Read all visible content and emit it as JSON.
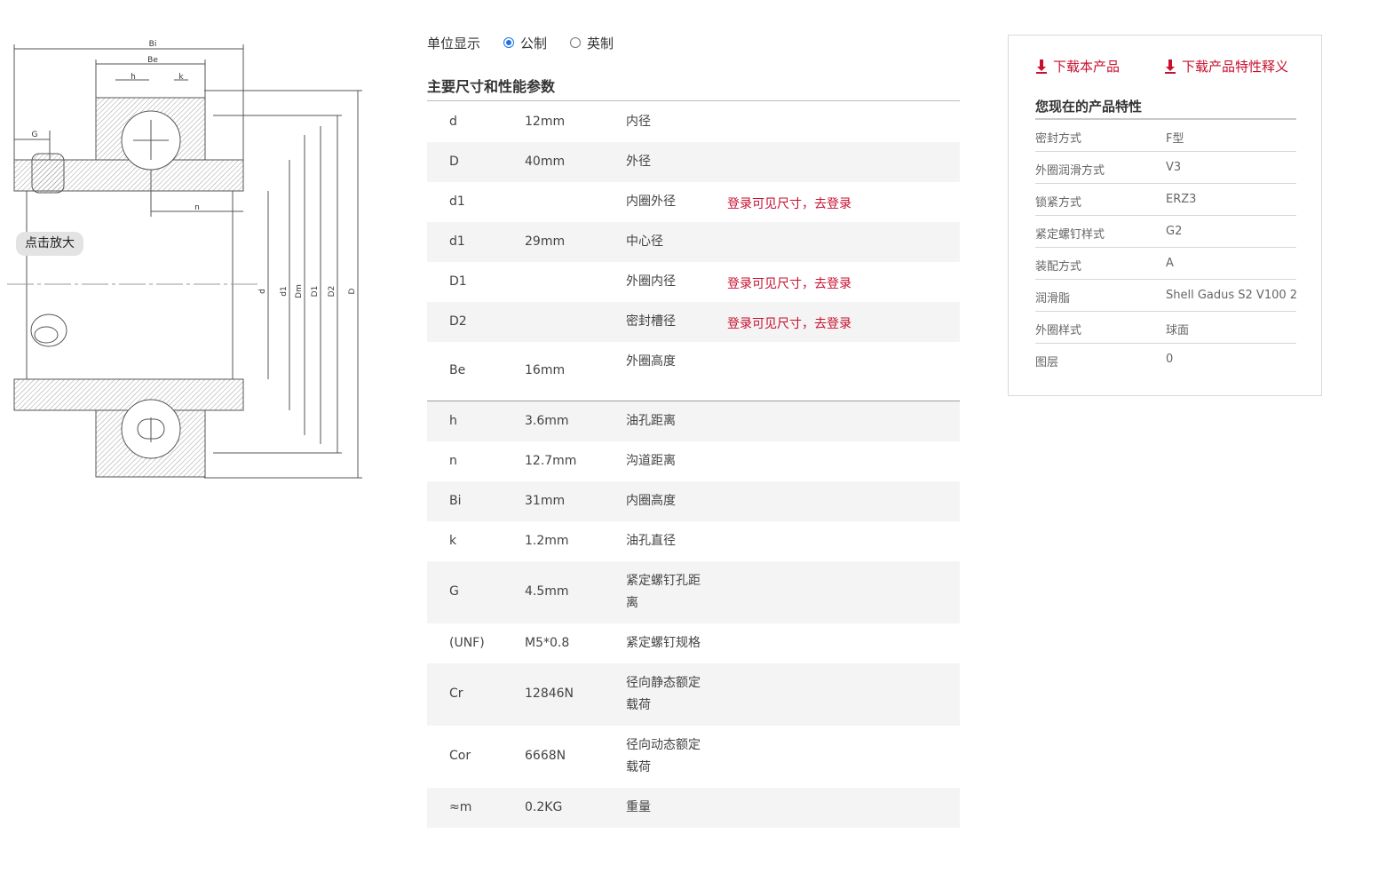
{
  "drawing": {
    "zoom_label": "点击放大",
    "dim_labels": {
      "Bi": "Bi",
      "Be": "Be",
      "h": "h",
      "k": "k",
      "G": "G",
      "n": "n",
      "d": "d",
      "d1": "d1",
      "Dm": "Dm",
      "D1": "D1",
      "D2": "D2",
      "D": "D"
    }
  },
  "unit": {
    "label": "单位显示",
    "options": [
      "公制",
      "英制"
    ],
    "selected": "公制"
  },
  "spec": {
    "title": "主要尺寸和性能参数",
    "login_text": "登录可见尺寸，去登录",
    "rows": [
      {
        "sym": "d",
        "val": "12mm",
        "desc": "内径",
        "note": ""
      },
      {
        "sym": "D",
        "val": "40mm",
        "desc": "外径",
        "note": ""
      },
      {
        "sym": "d1",
        "val": "",
        "desc": "内圈外径",
        "note": "登录可见尺寸，去登录"
      },
      {
        "sym": "d1",
        "val": "29mm",
        "desc": "中心径",
        "note": ""
      },
      {
        "sym": "D1",
        "val": "",
        "desc": "外圈内径",
        "note": "登录可见尺寸，去登录"
      },
      {
        "sym": "D2",
        "val": "",
        "desc": "密封槽径",
        "note": "登录可见尺寸，去登录"
      },
      {
        "sym": "Be",
        "val": "16mm",
        "desc": "外圈高度",
        "note": ""
      },
      {
        "sym": "h",
        "val": "3.6mm",
        "desc": "油孔距离",
        "note": ""
      },
      {
        "sym": "n",
        "val": "12.7mm",
        "desc": "沟道距离",
        "note": ""
      },
      {
        "sym": "Bi",
        "val": "31mm",
        "desc": "内圈高度",
        "note": ""
      },
      {
        "sym": "k",
        "val": "1.2mm",
        "desc": "油孔直径",
        "note": ""
      },
      {
        "sym": "G",
        "val": "4.5mm",
        "desc": "紧定螺钉孔距离",
        "note": ""
      },
      {
        "sym": "(UNF)",
        "val": "M5*0.8",
        "desc": "紧定螺钉规格",
        "note": ""
      },
      {
        "sym": "Cr",
        "val": "12846N",
        "desc": "径向静态额定载荷",
        "note": ""
      },
      {
        "sym": "Cor",
        "val": "6668N",
        "desc": "径向动态额定载荷",
        "note": ""
      },
      {
        "sym": "≈m",
        "val": "0.2KG",
        "desc": "重量",
        "note": ""
      }
    ]
  },
  "panel": {
    "download_product": "下载本产品",
    "download_features": "下载产品特性释义",
    "title": "您现在的产品特性",
    "features": [
      {
        "key": "密封方式",
        "value": "F型"
      },
      {
        "key": "外圈润滑方式",
        "value": "V3"
      },
      {
        "key": "锁紧方式",
        "value": "ERZ3"
      },
      {
        "key": "紧定螺钉样式",
        "value": "G2"
      },
      {
        "key": "装配方式",
        "value": "A"
      },
      {
        "key": "润滑脂",
        "value": "Shell Gadus S2 V100 2"
      },
      {
        "key": "外圈样式",
        "value": "球面"
      },
      {
        "key": "图层",
        "value": "0"
      }
    ]
  },
  "colors": {
    "accent": "#c8102e",
    "radio": "#1a73e8",
    "row_shade": "#f4f4f4"
  }
}
